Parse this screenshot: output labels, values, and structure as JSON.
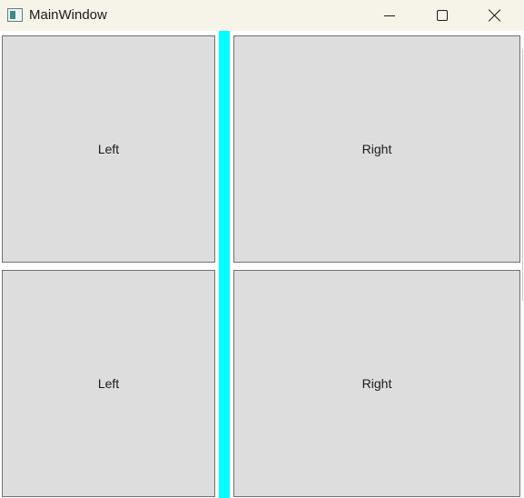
{
  "window": {
    "title": "MainWindow",
    "icon": "app-window-icon",
    "controls": {
      "minimize_icon": "minimize-icon",
      "maximize_icon": "maximize-icon",
      "close_icon": "close-icon"
    }
  },
  "grid": {
    "top_left": "Left",
    "bottom_left": "Left",
    "top_right": "Right",
    "bottom_right": "Right"
  },
  "colors": {
    "splitter": "#00ffff",
    "button_face": "#dddddd",
    "titlebar": "#f6f3e9"
  }
}
